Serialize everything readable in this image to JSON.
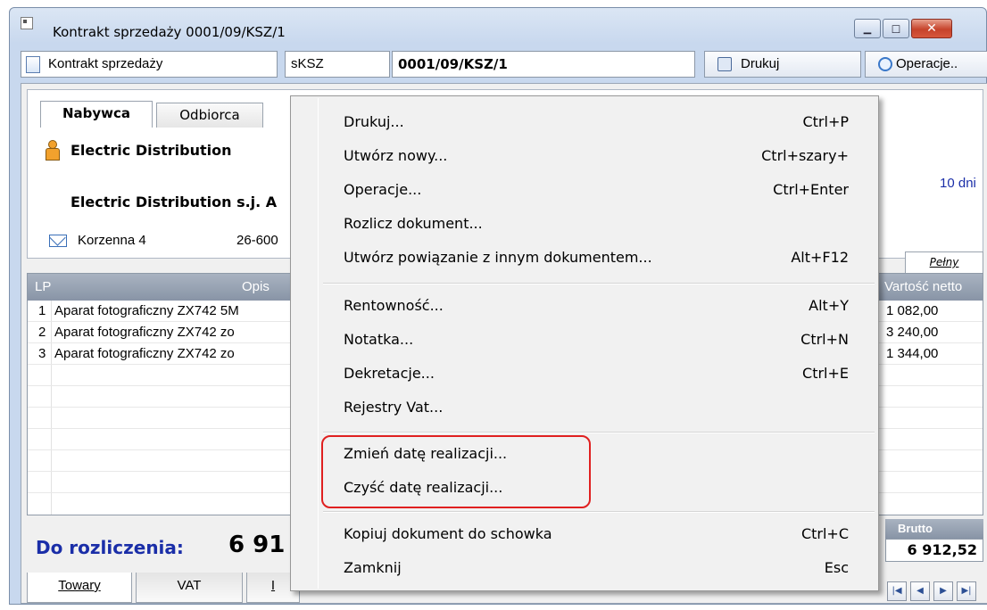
{
  "window": {
    "title": "Kontrakt sprzedaży 0001/09/KSZ/1",
    "controls": [
      "minimize",
      "maximize",
      "close"
    ]
  },
  "toolbar": {
    "doc_type": "Kontrakt sprzedaży",
    "series": "sKSZ",
    "number": "0001/09/KSZ/1",
    "print_label": "Drukuj",
    "operations_label": "Operacje.."
  },
  "header": {
    "tabs": [
      {
        "label": "Nabywca",
        "active": true
      },
      {
        "label": "Odbiorca",
        "active": false
      }
    ],
    "buyer_name": "Electric Distribution",
    "buyer_full_name": "Electric Distribution s.j. A",
    "address_street": "Korzenna 4",
    "address_zip": "26-600",
    "payment_term": "10 dni",
    "view_tab": "Pełny"
  },
  "items_grid": {
    "columns": [
      "LP",
      "Opis",
      "Vartość netto"
    ],
    "rows": [
      {
        "lp": "1",
        "desc": "Aparat fotograficzny ZX742 5M",
        "net": "1 082,00"
      },
      {
        "lp": "2",
        "desc": "Aparat fotograficzny ZX742 zo",
        "net": "3 240,00"
      },
      {
        "lp": "3",
        "desc": "Aparat fotograficzny ZX742 zo",
        "net": "1 344,00"
      }
    ]
  },
  "summary": {
    "settle_label": "Do rozliczenia:",
    "settle_value": "6 91",
    "brutto_label": "Brutto",
    "brutto_value": "6 912,52"
  },
  "bottom_tabs": [
    "Towary",
    "VAT",
    "I"
  ],
  "nav_buttons": [
    "first",
    "prev",
    "next",
    "last"
  ],
  "context_menu": {
    "items": [
      {
        "label": "Drukuj...",
        "shortcut": "Ctrl+P"
      },
      {
        "label": "Utwórz nowy...",
        "shortcut": "Ctrl+szary+"
      },
      {
        "label": "Operacje...",
        "shortcut": "Ctrl+Enter"
      },
      {
        "label": "Rozlicz dokument...",
        "shortcut": ""
      },
      {
        "label": "Utwórz powiązanie z innym dokumentem...",
        "shortcut": "Alt+F12"
      },
      {
        "label": "Rentowność...",
        "shortcut": "Alt+Y"
      },
      {
        "label": "Notatka...",
        "shortcut": "Ctrl+N"
      },
      {
        "label": "Dekretacje...",
        "shortcut": "Ctrl+E"
      },
      {
        "label": "Rejestry Vat...",
        "shortcut": ""
      },
      {
        "label": "Zmień datę realizacji...",
        "shortcut": ""
      },
      {
        "label": "Czyść datę realizacji...",
        "shortcut": ""
      },
      {
        "label": "Kopiuj dokument do schowka",
        "shortcut": "Ctrl+C"
      },
      {
        "label": "Zamknij",
        "shortcut": "Esc"
      }
    ]
  },
  "highlight_color": "#e02020"
}
